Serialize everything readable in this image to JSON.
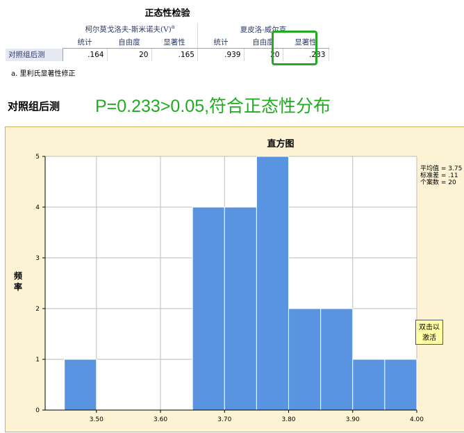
{
  "table": {
    "title": "正态性检验",
    "group_ks": "柯尔莫戈洛夫-斯米诺夫(V)",
    "group_ks_sup": "a",
    "group_sw": "夏皮洛-威尔克",
    "headers": [
      "统计",
      "自由度",
      "显著性",
      "统计",
      "自由度",
      "显著性"
    ],
    "row_label": "对照组后测",
    "values": [
      ".164",
      "20",
      ".165",
      ".939",
      "20",
      ".233"
    ],
    "footnote": "a. 里利氏显著性修正"
  },
  "caption": {
    "label": "对照组后测",
    "result": "P=0.233>0.05,符合正态性分布"
  },
  "activate_box": {
    "line1": "双击以",
    "line2": "激活"
  },
  "chart_data": {
    "type": "bar",
    "title": "直方图",
    "ylabel": "频率",
    "xlabel": "",
    "bin_width": 0.05,
    "bins": [
      {
        "center": 3.475,
        "count": 1
      },
      {
        "center": 3.525,
        "count": 0
      },
      {
        "center": 3.575,
        "count": 0
      },
      {
        "center": 3.625,
        "count": 0
      },
      {
        "center": 3.675,
        "count": 4
      },
      {
        "center": 3.725,
        "count": 4
      },
      {
        "center": 3.775,
        "count": 5
      },
      {
        "center": 3.825,
        "count": 2
      },
      {
        "center": 3.875,
        "count": 2
      },
      {
        "center": 3.925,
        "count": 1
      },
      {
        "center": 3.975,
        "count": 1
      }
    ],
    "xlim": [
      3.42,
      4.0
    ],
    "ylim": [
      0,
      5
    ],
    "x_ticks": [
      "3.50",
      "3.60",
      "3.70",
      "3.80",
      "3.90",
      "4.00"
    ],
    "y_ticks": [
      "0",
      "1",
      "2",
      "3",
      "4",
      "5"
    ],
    "grid": true,
    "stats": [
      "平均值 = 3.75",
      "标准差 = .11",
      "个案数 = 20"
    ],
    "colors": {
      "bar": "#5a94e0",
      "background": "#fbf3d4",
      "highlight": "#22aa22"
    }
  }
}
